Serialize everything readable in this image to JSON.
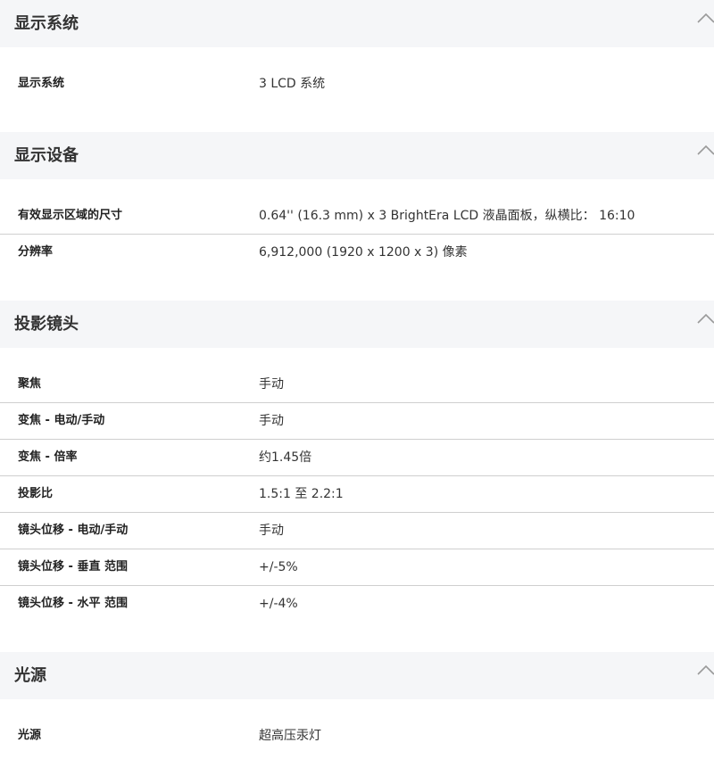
{
  "sections": [
    {
      "title": "显示系统",
      "rows": [
        {
          "label": "显示系统",
          "value": "3 LCD 系统"
        }
      ]
    },
    {
      "title": "显示设备",
      "rows": [
        {
          "label": "有效显示区域的尺寸",
          "value": "0.64'' (16.3 mm) x 3 BrightEra LCD 液晶面板，纵横比： 16:10"
        },
        {
          "label": "分辨率",
          "value": "6,912,000 (1920 x 1200 x 3) 像素"
        }
      ]
    },
    {
      "title": "投影镜头",
      "rows": [
        {
          "label": "聚焦",
          "value": "手动"
        },
        {
          "label": "变焦 - 电动/手动",
          "value": "手动"
        },
        {
          "label": "变焦 - 倍率",
          "value": "约1.45倍"
        },
        {
          "label": "投影比",
          "value": "1.5:1 至 2.2:1"
        },
        {
          "label": "镜头位移 - 电动/手动",
          "value": "手动"
        },
        {
          "label": "镜头位移 - 垂直 范围",
          "value": "+/-5%"
        },
        {
          "label": "镜头位移 - 水平 范围",
          "value": "+/-4%"
        }
      ]
    },
    {
      "title": "光源",
      "rows": [
        {
          "label": "光源",
          "value": "超高压汞灯"
        }
      ]
    }
  ],
  "icons": {
    "collapse": "chevron-up-icon"
  },
  "colors": {
    "header_bg": "#f5f6f8",
    "divider": "#cfcfcf",
    "text": "#222222"
  }
}
